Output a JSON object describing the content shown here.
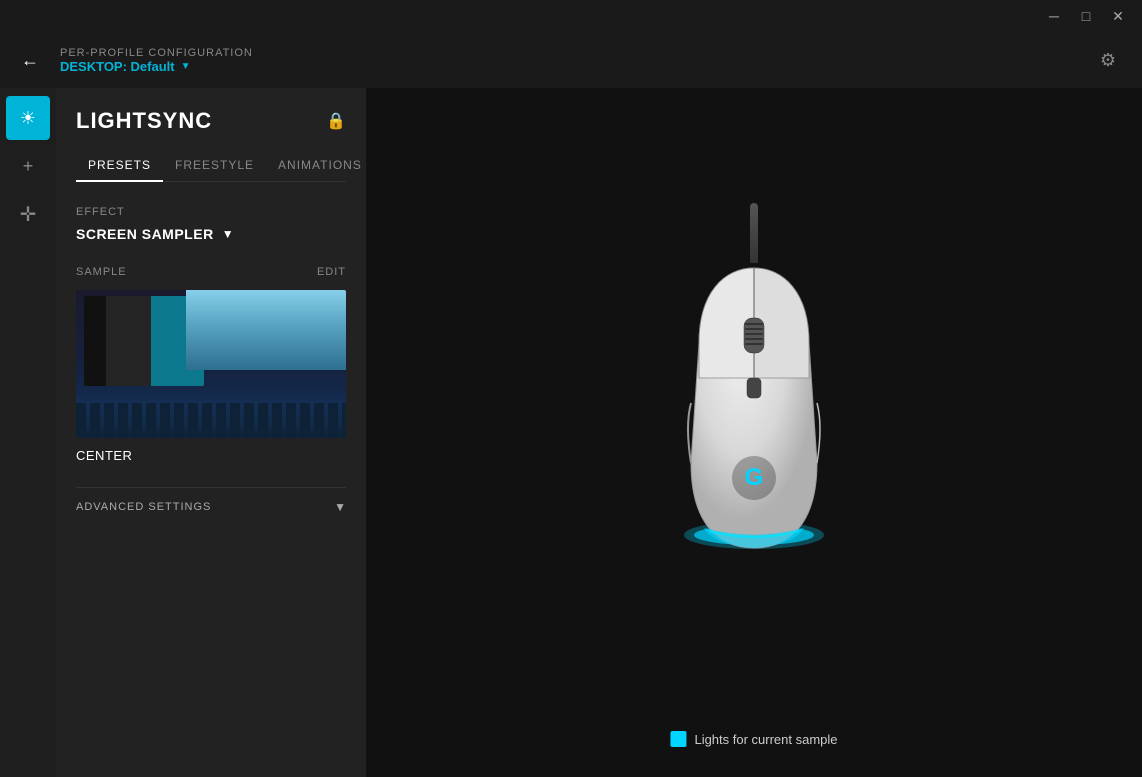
{
  "titlebar": {
    "minimize_label": "─",
    "maximize_label": "□",
    "close_label": "✕"
  },
  "header": {
    "per_profile_label": "PER-PROFILE CONFIGURATION",
    "profile_name": "DESKTOP: Default",
    "dropdown_arrow": "▼"
  },
  "sidebar": {
    "icons": [
      {
        "name": "lightsync-icon",
        "label": "☀",
        "active": true
      },
      {
        "name": "plus-icon",
        "label": "+",
        "active": false
      },
      {
        "name": "move-icon",
        "label": "⊹",
        "active": false
      }
    ]
  },
  "panel": {
    "title": "LIGHTSYNC",
    "tabs": [
      {
        "id": "presets",
        "label": "PRESETS",
        "active": true
      },
      {
        "id": "freestyle",
        "label": "FREESTYLE",
        "active": false
      },
      {
        "id": "animations",
        "label": "ANIMATIONS",
        "active": false
      }
    ],
    "effect_label": "EFFECT",
    "effect_name": "SCREEN SAMPLER",
    "sample_label": "SAMPLE",
    "edit_label": "EDIT",
    "center_label": "CENTER",
    "advanced_label": "ADVANCED SETTINGS"
  },
  "legend": {
    "label": "Lights for current sample"
  }
}
